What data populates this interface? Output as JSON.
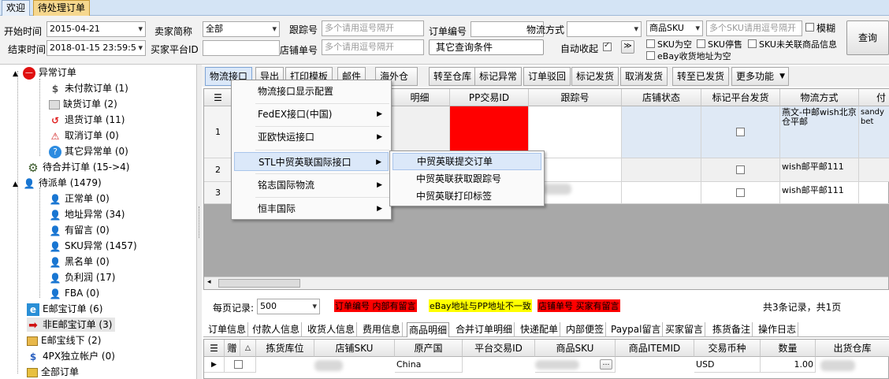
{
  "tabs": [
    {
      "label": "欢迎"
    },
    {
      "label": "待处理订单"
    }
  ],
  "filters": {
    "start_time_label": "开始时间",
    "start_time_value": "2015-04-21",
    "end_time_label": "结束时间",
    "end_time_value": "2018-01-15 23:59:5",
    "seller_label": "卖家简称",
    "seller_value": "全部",
    "buyer_platform_label": "买家平台ID",
    "tracking_label": "跟踪号",
    "tracking_placeholder": "多个请用逗号隔开",
    "store_no_label": "店铺单号",
    "store_no_placeholder": "多个请用逗号隔开",
    "order_no_label": "订单编号",
    "other_query_label": "其它查询条件",
    "shipping_label": "物流方式",
    "auto_collapse_label": "自动收起",
    "sku_select_value": "商品SKU",
    "sku_placeholder": "多个SKU请用逗号隔开",
    "fuzzy_label": "模糊",
    "sku_empty_label": "SKU为空",
    "sku_stopped_label": "SKU停售",
    "sku_unlinked_label": "SKU未关联商品信息",
    "ebay_addr_empty_label": "eBay收货地址为空",
    "query_button": "查询"
  },
  "tree": [
    {
      "label": "异常订单",
      "icon": "no-entry-icon"
    },
    {
      "label": "未付款订单 (1)",
      "icon": "dollar-icon"
    },
    {
      "label": "缺货订单 (2)",
      "icon": "box-icon"
    },
    {
      "label": "退货订单 (11)",
      "icon": "return-icon"
    },
    {
      "label": "取消订单 (0)",
      "icon": "warning-icon"
    },
    {
      "label": "其它异常单 (0)",
      "icon": "help-icon"
    },
    {
      "label": "待合并订单 (15->4)",
      "icon": "gear-icon"
    },
    {
      "label": "待派单 (1479)",
      "icon": "user-icon"
    },
    {
      "label": "正常单 (0)",
      "icon": "user-icon"
    },
    {
      "label": "地址异常 (34)",
      "icon": "user-icon"
    },
    {
      "label": "有留言 (0)",
      "icon": "user-icon"
    },
    {
      "label": "SKU异常 (1457)",
      "icon": "user-icon"
    },
    {
      "label": "黑名单 (0)",
      "icon": "user-icon"
    },
    {
      "label": "负利润 (17)",
      "icon": "user-icon"
    },
    {
      "label": "FBA (0)",
      "icon": "user-icon"
    },
    {
      "label": "E邮宝订单 (6)",
      "icon": "e-icon"
    },
    {
      "label": "非E邮宝订单 (3)",
      "icon": "arrow-right-icon"
    },
    {
      "label": "E邮宝线下 (2)",
      "icon": "package-icon"
    },
    {
      "label": "4PX独立帐户 (0)",
      "icon": "dollar-icon"
    },
    {
      "label": "全部订单",
      "icon": "folder-icon"
    }
  ],
  "toolbar": [
    "物流接口",
    "导出",
    "打印模板",
    "邮件",
    "海外仓",
    "转至仓库",
    "标记异常",
    "订单驳回",
    "标记发货",
    "取消发货",
    "转至已发货",
    "更多功能"
  ],
  "grid": {
    "columns": [
      "",
      "",
      "明细",
      "PP交易ID",
      "跟踪号",
      "店铺状态",
      "标记平台发货",
      "物流方式",
      "付"
    ],
    "rows": [
      {
        "num": "1",
        "shipping": "燕文-中邮wish北京仓平邮",
        "extra": "sandybet"
      },
      {
        "num": "2",
        "shipping": "wish邮平邮111",
        "extra": ""
      },
      {
        "num": "3",
        "shipping": "wish邮平邮111",
        "extra": ""
      }
    ]
  },
  "menu": {
    "items": [
      "物流接口显示配置",
      "FedEX接口(中国)",
      "亚欧快运接口",
      "STL中贸英联国际接口",
      "铭志国际物流",
      "恒丰国际"
    ],
    "submenu": [
      "中贸英联提交订单",
      "中贸英联获取跟踪号",
      "中贸英联打印标签"
    ]
  },
  "pager": {
    "per_page_label": "每页记录:",
    "per_page_value": "500",
    "legend_red": "订单编号  内部有留言",
    "legend_yellow": "eBay地址与PP地址不一致",
    "legend_red2": "店铺单号  买家有留言",
    "summary": "共3条记录，共1页"
  },
  "bottom_tabs": [
    "订单信息",
    "付款人信息",
    "收货人信息",
    "费用信息",
    "商品明细",
    "合并订单明细",
    "快递配单",
    "内部便签",
    "Paypal留言",
    "买家留言",
    "拣货备注",
    "操作日志"
  ],
  "detail": {
    "columns": [
      "赠",
      "",
      "拣货库位",
      "店铺SKU",
      "原产国",
      "平台交易ID",
      "商品SKU",
      "商品ITEMID",
      "交易币种",
      "数量",
      "出货仓库"
    ],
    "row": {
      "country": "China",
      "currency": "USD",
      "qty": "1.00"
    }
  },
  "colors": {
    "red": "#ff0000",
    "yellow": "#ffff00",
    "tab_active": "#f6d78e"
  }
}
